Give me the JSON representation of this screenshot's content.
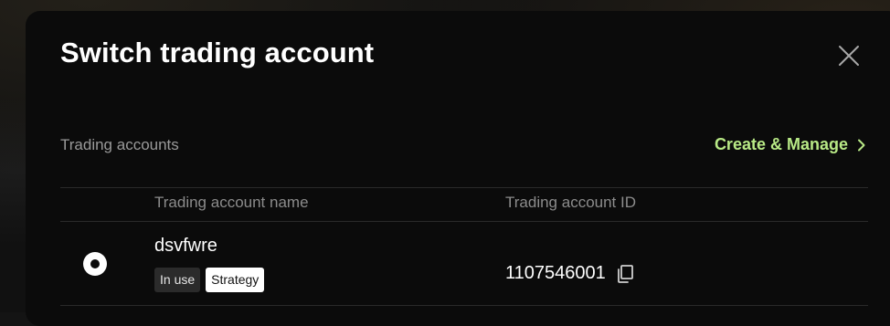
{
  "modal": {
    "title": "Switch trading account"
  },
  "section": {
    "label": "Trading accounts",
    "action_label": "Create & Manage"
  },
  "table": {
    "columns": [
      "Trading account name",
      "Trading account ID"
    ],
    "rows": [
      {
        "selected": true,
        "name": "dsvfwre",
        "badges": [
          "In use",
          "Strategy"
        ],
        "id": "1107546001"
      }
    ]
  },
  "icons": {
    "close": "close-icon",
    "action": "chevron-right-icon",
    "copy": "copy-icon"
  },
  "colors": {
    "accent": "#b8e986",
    "modal_bg": "#0b0b0b",
    "text_primary": "#ffffff",
    "text_secondary": "#9a9a9a"
  }
}
